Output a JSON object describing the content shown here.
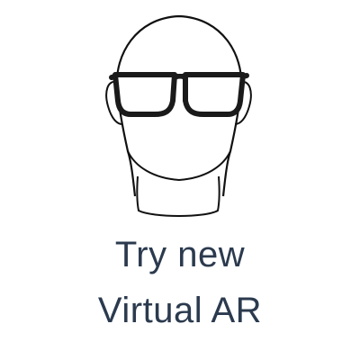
{
  "promo": {
    "line1": "Try new",
    "line2": "Virtual AR",
    "illustration": {
      "subject": "head-outline",
      "accessory": "eyeglasses-icon"
    },
    "colors": {
      "text": "#2b3a4e",
      "outline": "#111111",
      "frame": "#1a1a1a",
      "background": "#ffffff"
    }
  }
}
